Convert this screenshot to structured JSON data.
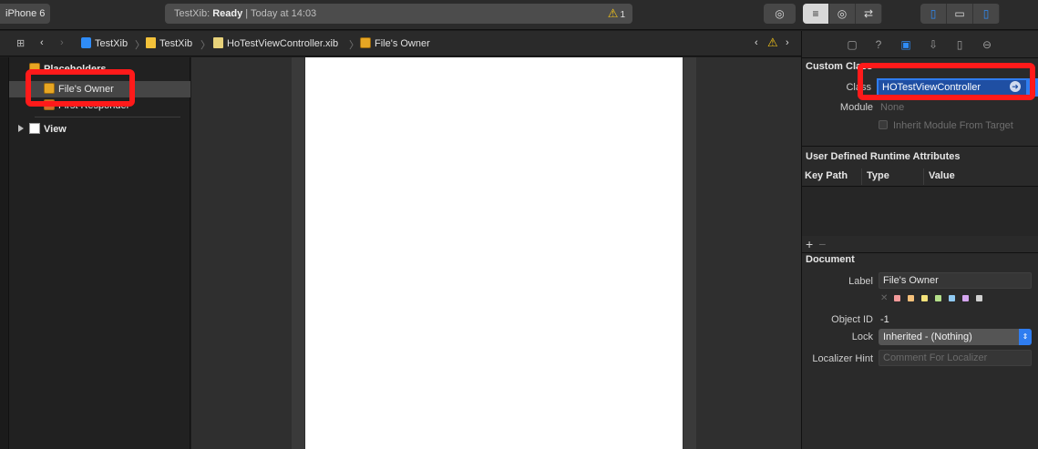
{
  "toolbar": {
    "scheme": "iPhone 6",
    "activity_app": "TestXib:",
    "activity_status": "Ready",
    "activity_time": "| Today at 14:03",
    "warning_count": "1"
  },
  "jumpbar": {
    "items": [
      "TestXib",
      "TestXib",
      "HoTestViewController.xib",
      "File's Owner"
    ]
  },
  "outline": {
    "placeholders_label": "Placeholders",
    "files_owner_label": "File's Owner",
    "first_responder_label": "First Responder",
    "view_label": "View"
  },
  "inspector": {
    "custom_class_title": "Custom Class",
    "class_label": "Class",
    "class_value": "HOTestViewController",
    "module_label": "Module",
    "module_placeholder": "None",
    "inherit_label": "Inherit Module From Target",
    "udra_title": "User Defined Runtime Attributes",
    "col_keypath": "Key Path",
    "col_type": "Type",
    "col_value": "Value",
    "document_title": "Document",
    "doc_label_label": "Label",
    "doc_label_value": "File's Owner",
    "object_id_label": "Object ID",
    "object_id_value": "-1",
    "lock_label": "Lock",
    "lock_value": "Inherited - (Nothing)",
    "localizer_label": "Localizer Hint",
    "localizer_placeholder": "Comment For Localizer",
    "swatch_colors": [
      "#f29a9a",
      "#f5c07a",
      "#f3e27a",
      "#b5e08a",
      "#8fc9f2",
      "#d4a6ef",
      "#d0d0d0"
    ]
  }
}
